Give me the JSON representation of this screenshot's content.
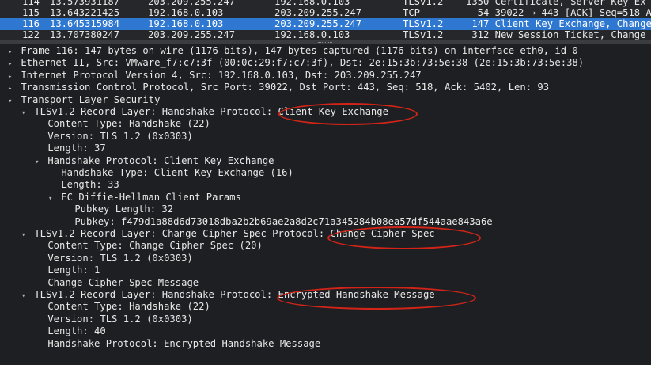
{
  "packet_list": [
    {
      "no": "114",
      "time": "13.573931187",
      "src": "203.209.255.247",
      "dst": "192.168.0.103",
      "proto": "TLSv1.2",
      "info": "1350 Certificate, Server Key Ex",
      "selected": false
    },
    {
      "no": "115",
      "time": "13.643221425",
      "src": "192.168.0.103",
      "dst": "203.209.255.247",
      "proto": "TCP",
      "info": "  54 39022 → 443 [ACK] Seq=518 A",
      "selected": false
    },
    {
      "no": "116",
      "time": "13.645315984",
      "src": "192.168.0.103",
      "dst": "203.209.255.247",
      "proto": "TLSv1.2",
      "info": " 147 Client Key Exchange, Change",
      "selected": true
    },
    {
      "no": "122",
      "time": "13.707380247",
      "src": "203.209.255.247",
      "dst": "192.168.0.103",
      "proto": "TLSv1.2",
      "info": " 312 New Session Ticket, Change",
      "selected": false
    }
  ],
  "details": [
    {
      "indent": 0,
      "toggle": "▸",
      "text": "Frame 116: 147 bytes on wire (1176 bits), 147 bytes captured (1176 bits) on interface eth0, id 0"
    },
    {
      "indent": 0,
      "toggle": "▸",
      "text": "Ethernet II, Src: VMware_f7:c7:3f (00:0c:29:f7:c7:3f), Dst: 2e:15:3b:73:5e:38 (2e:15:3b:73:5e:38)"
    },
    {
      "indent": 0,
      "toggle": "▸",
      "text": "Internet Protocol Version 4, Src: 192.168.0.103, Dst: 203.209.255.247"
    },
    {
      "indent": 0,
      "toggle": "▸",
      "text": "Transmission Control Protocol, Src Port: 39022, Dst Port: 443, Seq: 518, Ack: 5402, Len: 93"
    },
    {
      "indent": 0,
      "toggle": "▾",
      "text": "Transport Layer Security"
    },
    {
      "indent": 1,
      "toggle": "▾",
      "text": "TLSv1.2 Record Layer: Handshake Protocol: Client Key Exchange"
    },
    {
      "indent": 2,
      "toggle": "",
      "text": "Content Type: Handshake (22)"
    },
    {
      "indent": 2,
      "toggle": "",
      "text": "Version: TLS 1.2 (0x0303)"
    },
    {
      "indent": 2,
      "toggle": "",
      "text": "Length: 37"
    },
    {
      "indent": 2,
      "toggle": "▾",
      "text": "Handshake Protocol: Client Key Exchange"
    },
    {
      "indent": 3,
      "toggle": "",
      "text": "Handshake Type: Client Key Exchange (16)"
    },
    {
      "indent": 3,
      "toggle": "",
      "text": "Length: 33"
    },
    {
      "indent": 3,
      "toggle": "▾",
      "text": "EC Diffie-Hellman Client Params"
    },
    {
      "indent": 4,
      "toggle": "",
      "text": "Pubkey Length: 32"
    },
    {
      "indent": 4,
      "toggle": "",
      "text": "Pubkey: f479d1a88d6d73018dba2b2b69ae2a8d2c71a345284b08ea57df544aae843a6e"
    },
    {
      "indent": 1,
      "toggle": "▾",
      "text": "TLSv1.2 Record Layer: Change Cipher Spec Protocol: Change Cipher Spec"
    },
    {
      "indent": 2,
      "toggle": "",
      "text": "Content Type: Change Cipher Spec (20)"
    },
    {
      "indent": 2,
      "toggle": "",
      "text": "Version: TLS 1.2 (0x0303)"
    },
    {
      "indent": 2,
      "toggle": "",
      "text": "Length: 1"
    },
    {
      "indent": 2,
      "toggle": "",
      "text": "Change Cipher Spec Message"
    },
    {
      "indent": 1,
      "toggle": "▾",
      "text": "TLSv1.2 Record Layer: Handshake Protocol: Encrypted Handshake Message"
    },
    {
      "indent": 2,
      "toggle": "",
      "text": "Content Type: Handshake (22)"
    },
    {
      "indent": 2,
      "toggle": "",
      "text": "Version: TLS 1.2 (0x0303)"
    },
    {
      "indent": 2,
      "toggle": "",
      "text": "Length: 40"
    },
    {
      "indent": 2,
      "toggle": "",
      "text": "Handshake Protocol: Encrypted Handshake Message"
    }
  ],
  "colors": {
    "selected_row": "#2f78d2",
    "highlight_ellipse": "#d32418",
    "background": "#1e1f22"
  }
}
